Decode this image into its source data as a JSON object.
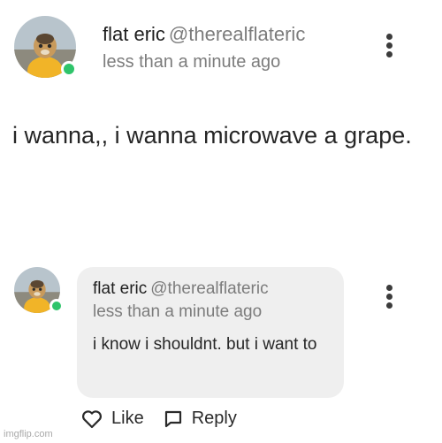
{
  "post": {
    "author_name": "flat eric",
    "author_handle": "@therealflateric",
    "timestamp": "less than a minute ago",
    "body": "i wanna,, i wanna microwave a grape.",
    "avatar_icon": "profile-photo-icon",
    "online_status_color": "#2fc46a",
    "menu_icon": "more-vertical-icon"
  },
  "reply": {
    "author_name": "flat eric",
    "author_handle": "@therealflateric",
    "timestamp": "less than a minute ago",
    "body": "i know i shouldnt. but i want to",
    "bubble_color": "#efefef",
    "avatar_icon": "profile-photo-icon",
    "menu_icon": "more-vertical-icon"
  },
  "actions": {
    "like_label": "Like",
    "like_icon": "heart-outline-icon",
    "reply_label": "Reply",
    "reply_icon": "speech-bubble-icon"
  },
  "watermark": "imgflip.com"
}
